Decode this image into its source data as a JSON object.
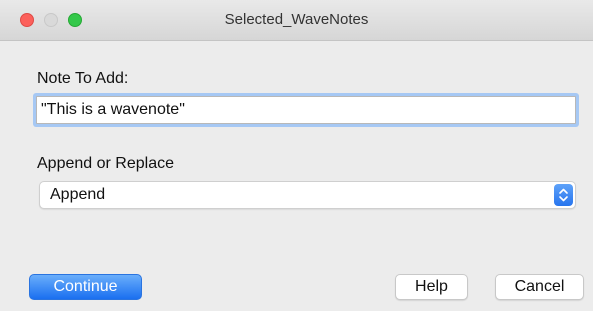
{
  "window": {
    "title": "Selected_WaveNotes"
  },
  "note_field": {
    "label": "Note To Add:",
    "value": "\"This is a wavenote\""
  },
  "mode_select": {
    "label": "Append or Replace",
    "value": "Append"
  },
  "buttons": {
    "continue": "Continue",
    "help": "Help",
    "cancel": "Cancel"
  },
  "colors": {
    "accent": "#1a6ff0",
    "close": "#fc605b",
    "maximize": "#34c84a"
  }
}
